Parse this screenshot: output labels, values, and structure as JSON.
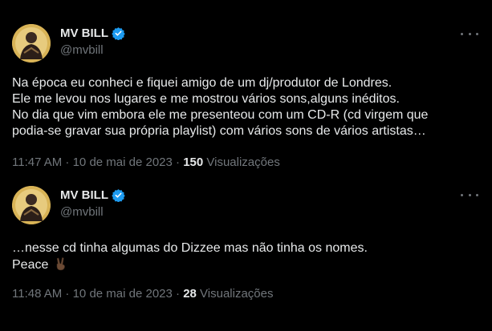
{
  "tweets": [
    {
      "author_name": "MV BILL",
      "handle": "@mvbill",
      "lines": [
        "Na época eu conheci e fiquei amigo de um dj/produtor de Londres.",
        "Ele me levou nos lugares e me mostrou vários sons,alguns inéditos.",
        "No dia que vim embora ele me presenteou com um CD-R (cd virgem que",
        "podia-se gravar sua própria playlist) com vários sons de vários artistas…"
      ],
      "timestamp": "11:47 AM · 10 de mai de 2023 · ",
      "views_count": "150",
      "views_label": "Visualizações"
    },
    {
      "author_name": "MV BILL",
      "handle": "@mvbill",
      "lines": [
        "…nesse cd tinha algumas do Dizzee mas não tinha os nomes.",
        "Peace"
      ],
      "timestamp": "11:48 AM · 10 de mai de 2023 · ",
      "views_count": "28",
      "views_label": "Visualizações"
    }
  ],
  "icons": {
    "verified": "verified-badge-icon",
    "more": "more-options-icon",
    "peace_emoji": "victory-hand-emoji"
  },
  "colors": {
    "background": "#000000",
    "text_primary": "#e7e9ea",
    "text_secondary": "#71767b",
    "verified_blue": "#1d9bf0"
  }
}
